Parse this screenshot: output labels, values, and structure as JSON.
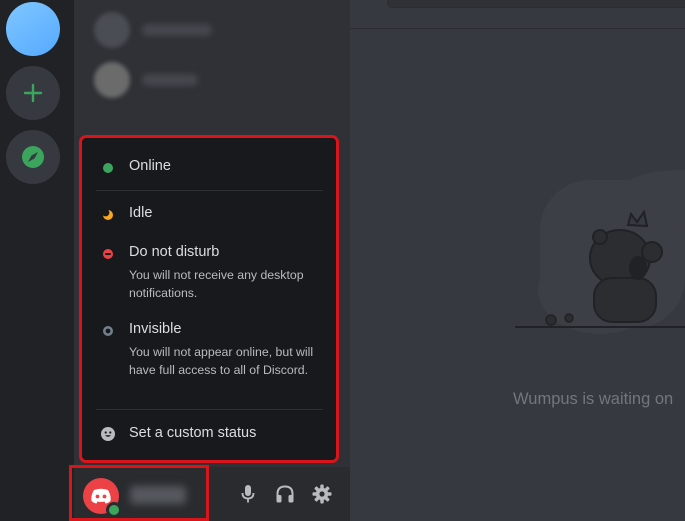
{
  "status_menu": {
    "options": [
      {
        "label": "Online",
        "description": ""
      },
      {
        "label": "Idle",
        "description": ""
      },
      {
        "label": "Do not disturb",
        "description": "You will not receive any desktop notifications."
      },
      {
        "label": "Invisible",
        "description": "You will not appear online, but will have full access to all of Discord."
      }
    ],
    "custom_status_label": "Set a custom status"
  },
  "main": {
    "empty_state_text": "Wumpus is waiting on"
  },
  "colors": {
    "online": "#3ba55d",
    "idle": "#faa81a",
    "dnd": "#ed4245",
    "invisible": "#747f8d",
    "highlight": "#d9141b"
  },
  "icons": {
    "add_server": "plus-icon",
    "explore": "compass-icon",
    "mic": "microphone-icon",
    "headphones": "headphones-icon",
    "settings": "gear-icon"
  }
}
